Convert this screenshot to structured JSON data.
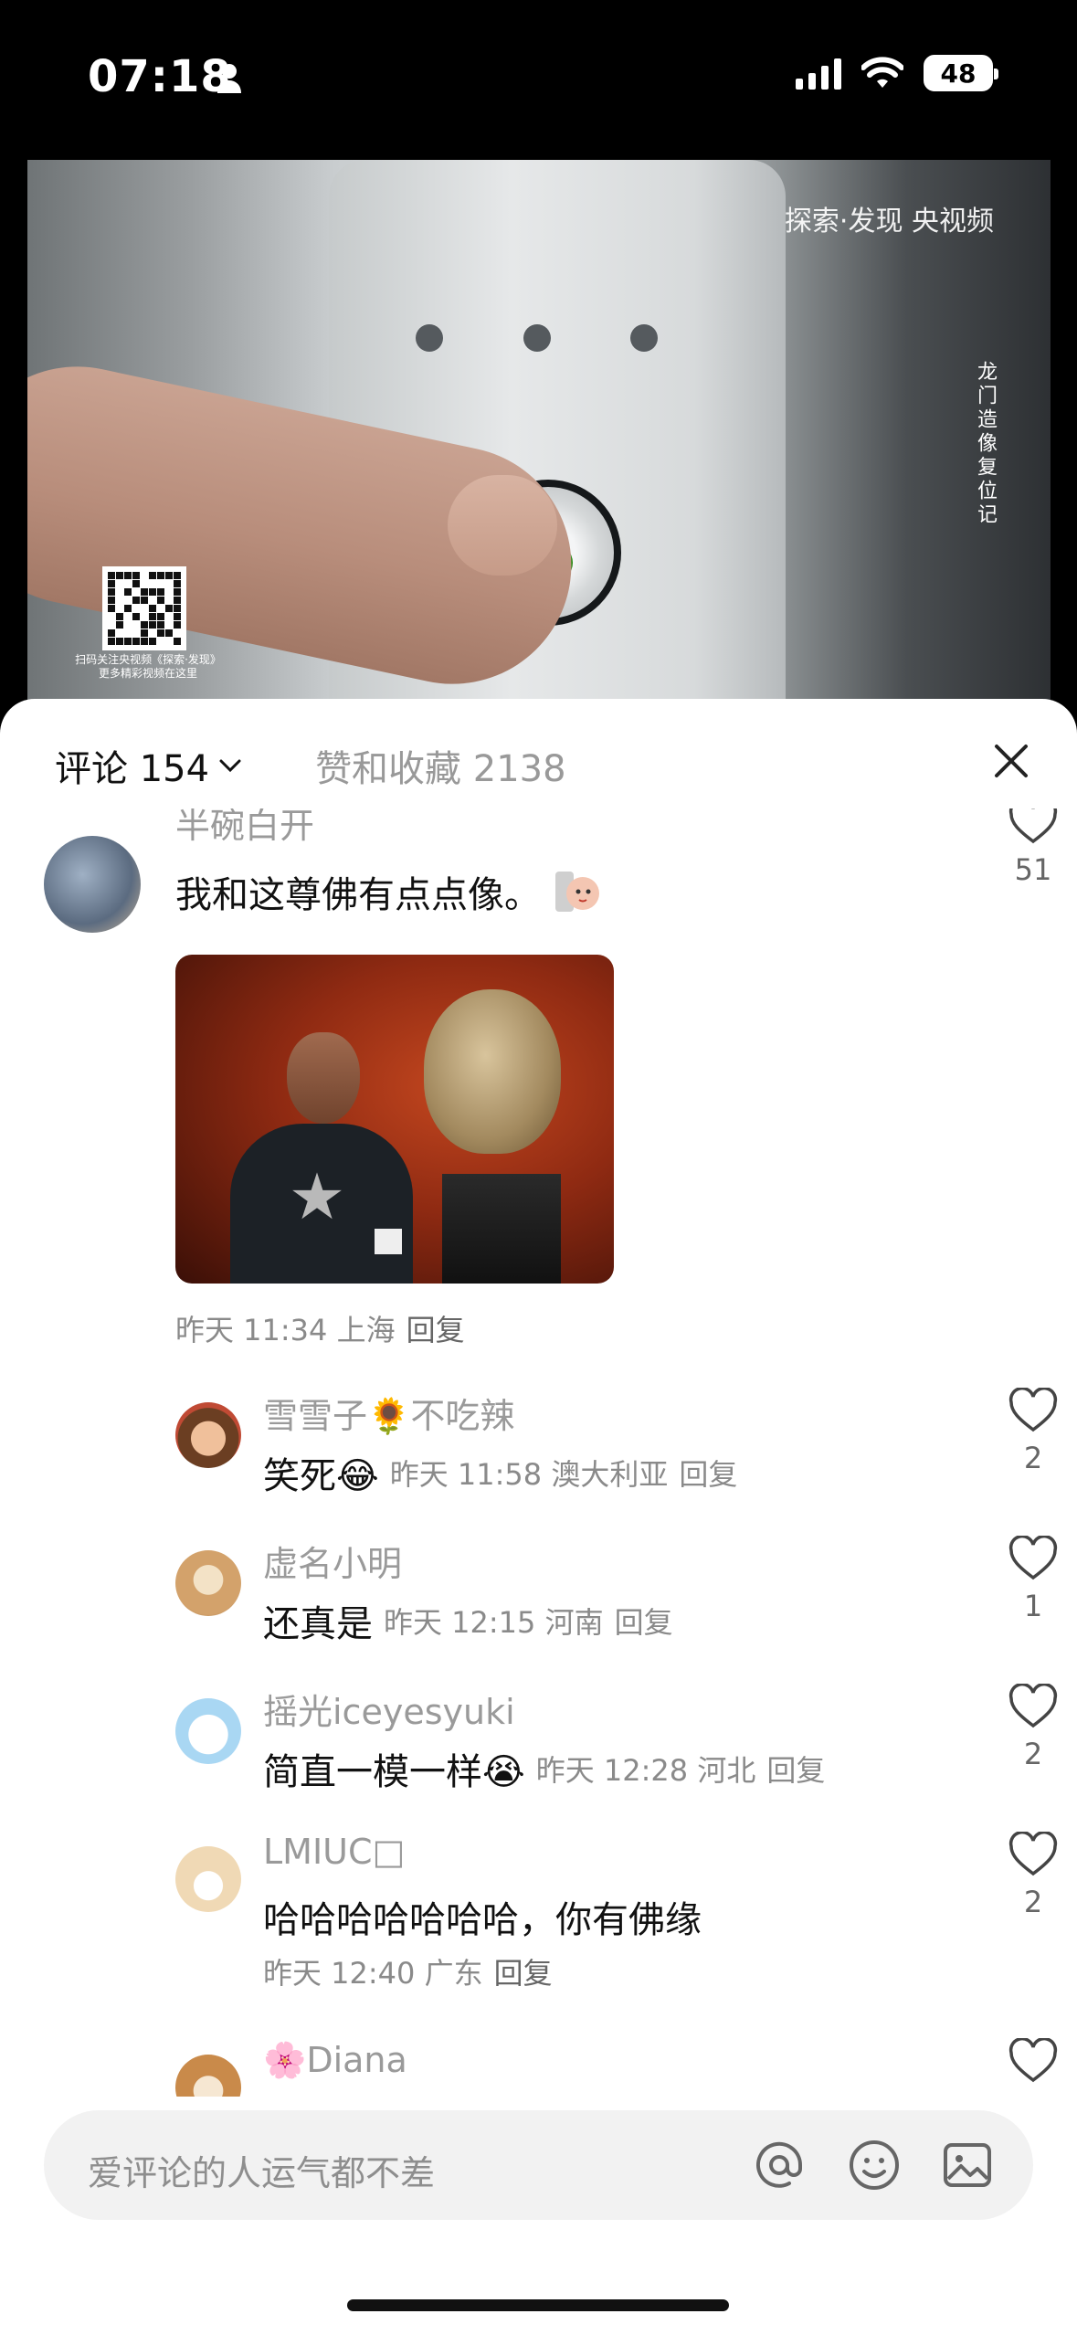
{
  "status_bar": {
    "time": "07:18",
    "battery": "48"
  },
  "video": {
    "brand": "探索·发现 央视频",
    "vertical_title": "龙门造像复位记",
    "qr_caption": "扫码关注央视频《探索·发现》 更多精彩视频在这里"
  },
  "tabs": {
    "comments": "评论 154",
    "likes": "赞和收藏 2138"
  },
  "comments": [
    {
      "name": "半碗白开",
      "text": "我和这尊佛有点点像。",
      "meta": "昨天 11:34 上海",
      "reply": "回复",
      "likes": "51",
      "replies": [
        {
          "name": "雪雪子🌻不吃辣",
          "text": "笑死😂",
          "meta": "昨天 11:58 澳大利亚",
          "reply": "回复",
          "likes": "2"
        },
        {
          "name": "虚名小明",
          "text": "还真是",
          "meta": "昨天 12:15 河南",
          "reply": "回复",
          "likes": "1"
        },
        {
          "name": "摇光iceyesyuki",
          "text": "简直一模一样😭",
          "meta": "昨天 12:28 河北",
          "reply": "回复",
          "likes": "2"
        },
        {
          "name": "LMIUC□",
          "text": "哈哈哈哈哈哈哈，你有佛缘",
          "meta": "昨天 12:40 广东",
          "reply": "回复",
          "likes": "2"
        },
        {
          "name": "🌸Diana",
          "text": "",
          "meta": "",
          "reply": "",
          "likes": ""
        }
      ]
    }
  ],
  "input": {
    "placeholder": "爱评论的人运气都不差"
  },
  "icons": [
    "person-icon",
    "signal-icon",
    "wifi-icon",
    "battery-icon",
    "chevron-down-icon",
    "close-icon",
    "heart-icon",
    "at-icon",
    "emoji-icon",
    "image-icon"
  ]
}
